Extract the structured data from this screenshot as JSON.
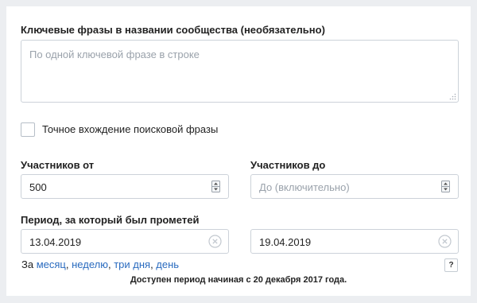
{
  "keywords": {
    "label": "Ключевые фразы в названии сообщества (необязательно)",
    "placeholder": "По одной ключевой фразе в строке"
  },
  "exact_match": {
    "label": "Точное вхождение поисковой фразы",
    "checked": false
  },
  "members_from": {
    "label": "Участников от",
    "value": "500"
  },
  "members_to": {
    "label": "Участников до",
    "placeholder": "До (включительно)"
  },
  "period": {
    "label": "Период, за который был прометей",
    "from": "13.04.2019",
    "to": "19.04.2019"
  },
  "quick_range": {
    "prefix": "За",
    "month": "месяц",
    "week": "неделю",
    "three_days": "три дня",
    "day": "день",
    "sep": ", "
  },
  "help": "?",
  "note": "Доступен период начиная с 20 декабря 2017 года."
}
